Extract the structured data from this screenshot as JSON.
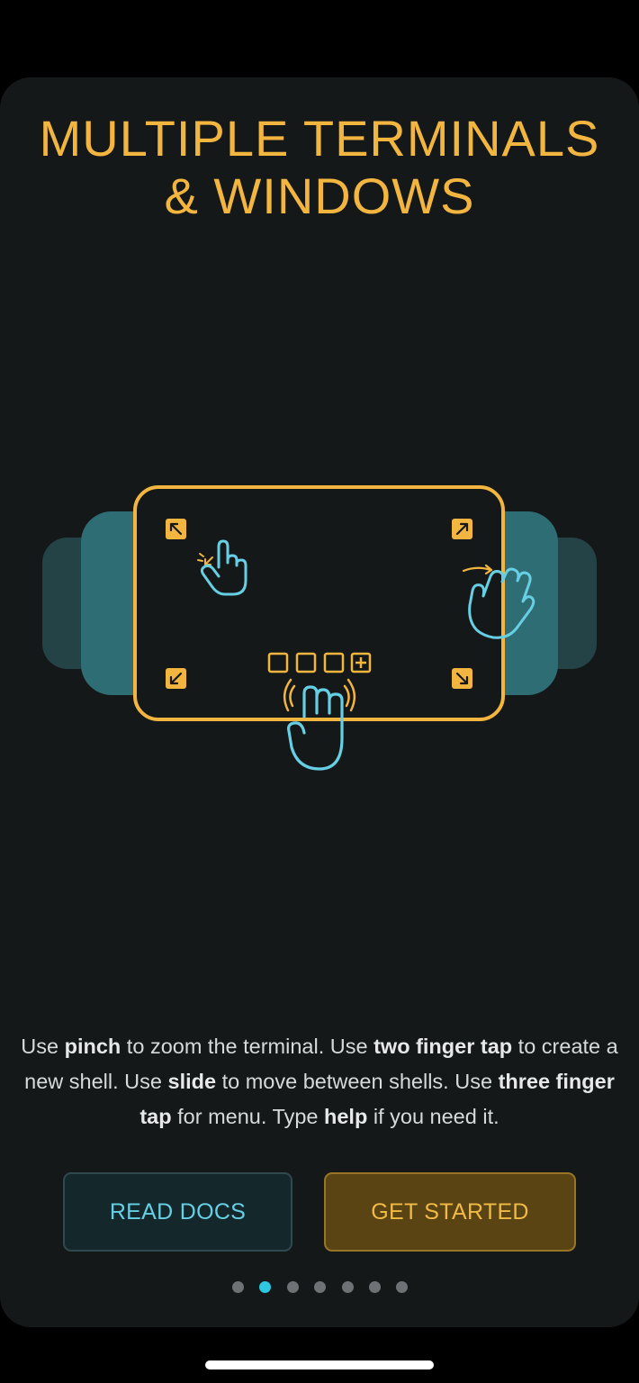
{
  "onboarding": {
    "title_line1": "MULTIPLE TERMINALS",
    "title_line2": "& WINDOWS",
    "description": {
      "s1_pre": "Use ",
      "s1_bold": "pinch",
      "s1_post": " to zoom the terminal. Use ",
      "s2_bold": "two finger tap",
      "s2_post": " to create a new shell. Use ",
      "s3_bold": "slide",
      "s3_post": " to move between shells. Use ",
      "s4_bold": "three finger tap",
      "s4_post": " for menu. Type ",
      "s5_bold": "help",
      "s5_post": " if you need it."
    },
    "buttons": {
      "read_docs": "READ DOCS",
      "get_started": "GET STARTED"
    },
    "pagination": {
      "total": 7,
      "active_index": 1
    },
    "illustration": {
      "icons": [
        "pinch-gesture-icon",
        "swipe-hand-icon",
        "tap-hand-icon",
        "expand-arrow-icon",
        "new-tab-plus-icon"
      ]
    },
    "colors": {
      "accent_yellow": "#F2B53F",
      "accent_cyan": "#67CFE4",
      "background": "#151819",
      "panel_back": "#2F6D75"
    }
  }
}
